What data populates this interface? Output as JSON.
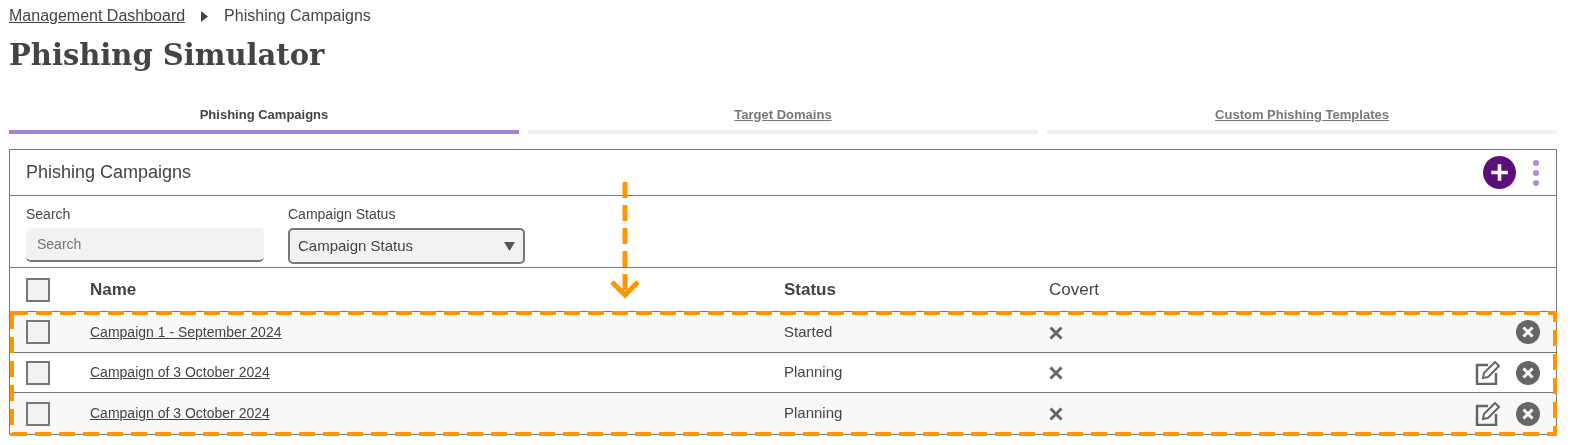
{
  "breadcrumb": [
    {
      "label": "Management Dashboard",
      "kind": "link"
    },
    {
      "label": "Phishing Campaigns",
      "kind": "current"
    }
  ],
  "title": "Phishing Simulator",
  "tabs": [
    {
      "label": "Phishing Campaigns",
      "selected": true
    },
    {
      "label": "Target Domains",
      "selected": false
    },
    {
      "label": "Custom Phishing Templates",
      "selected": false
    }
  ],
  "panel": {
    "title": "Phishing Campaigns",
    "filters": [
      {
        "kind": "text",
        "label": "Search",
        "placeholder": "Search"
      },
      {
        "kind": "select",
        "label": "Campaign Status",
        "value": "Campaign Status"
      }
    ],
    "table": {
      "select_all": {
        "checked": false
      },
      "columns": [
        "Name",
        "Status",
        "Covert"
      ],
      "rows": [
        {
          "checked": false,
          "name": "Campaign 1 - September 2024",
          "status": "Started",
          "covert": false,
          "editable": false
        },
        {
          "checked": false,
          "name": "Campaign of 3 October 2024",
          "status": "Planning",
          "covert": false,
          "editable": true
        },
        {
          "checked": false,
          "name": "Campaign of 3 October 2024",
          "status": "Planning",
          "covert": false,
          "editable": true
        }
      ]
    }
  }
}
